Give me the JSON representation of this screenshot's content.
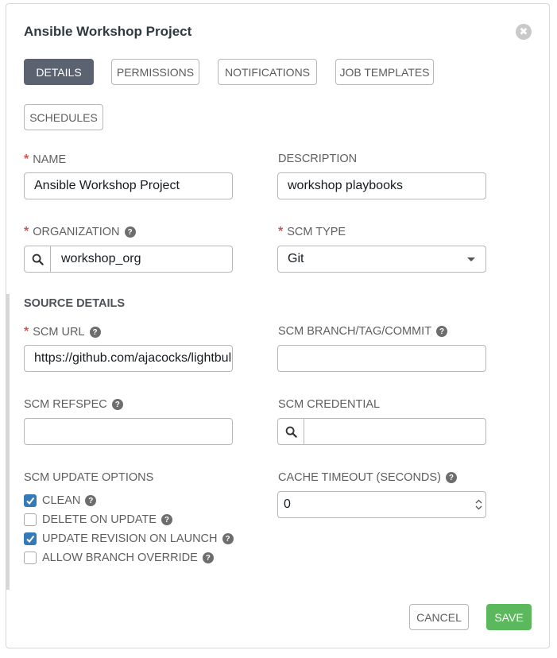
{
  "dialog": {
    "title": "Ansible Workshop Project",
    "close_symbol": "✖"
  },
  "tabs": [
    {
      "label": "DETAILS",
      "active": true
    },
    {
      "label": "PERMISSIONS",
      "active": false
    },
    {
      "label": "NOTIFICATIONS",
      "active": false
    },
    {
      "label": "JOB TEMPLATES",
      "active": false
    },
    {
      "label": "SCHEDULES",
      "active": false
    }
  ],
  "fields": {
    "name": {
      "label": "NAME",
      "required": "*",
      "value": "Ansible Workshop Project"
    },
    "description": {
      "label": "DESCRIPTION",
      "value": "workshop playbooks"
    },
    "organization": {
      "label": "ORGANIZATION",
      "required": "*",
      "value": "workshop_org"
    },
    "scm_type": {
      "label": "SCM TYPE",
      "required": "*",
      "value": "Git"
    }
  },
  "source_details": {
    "title": "SOURCE DETAILS",
    "scm_url": {
      "label": "SCM URL",
      "required": "*",
      "value": "https://github.com/ajacocks/lightbulb"
    },
    "scm_branch": {
      "label": "SCM BRANCH/TAG/COMMIT",
      "value": ""
    },
    "scm_refspec": {
      "label": "SCM REFSPEC",
      "value": ""
    },
    "scm_credential": {
      "label": "SCM CREDENTIAL",
      "value": ""
    },
    "update_options": {
      "label": "SCM UPDATE OPTIONS",
      "items": [
        {
          "label": "CLEAN",
          "checked": true
        },
        {
          "label": "DELETE ON UPDATE",
          "checked": false
        },
        {
          "label": "UPDATE REVISION ON LAUNCH",
          "checked": true
        },
        {
          "label": "ALLOW BRANCH OVERRIDE",
          "checked": false
        }
      ]
    },
    "cache_timeout": {
      "label": "CACHE TIMEOUT (SECONDS)",
      "value": "0"
    }
  },
  "help_symbol": "?",
  "footer": {
    "cancel_label": "CANCEL",
    "save_label": "SAVE"
  },
  "colors": {
    "active_tab": "#5c6370",
    "required": "#d9534f",
    "checkbox_checked": "#337ab7",
    "save_button": "#5cb85c"
  }
}
